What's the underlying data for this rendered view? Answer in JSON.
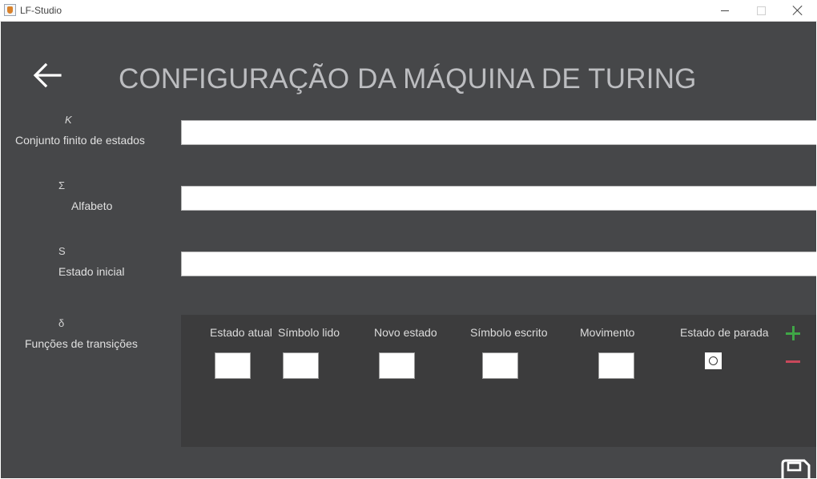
{
  "window": {
    "title": "LF-Studio"
  },
  "header": {
    "title": "CONFIGURAÇÃO DA MÁQUINA DE TURING"
  },
  "fields": [
    {
      "symbol": "K",
      "label": "Conjunto finito de estados",
      "value": ""
    },
    {
      "symbol": "Σ",
      "label": "Alfabeto",
      "value": ""
    },
    {
      "symbol": "S",
      "label": "Estado inicial",
      "value": ""
    }
  ],
  "transitions": {
    "symbol": "δ",
    "label": "Funções de transições",
    "columns": [
      "Estado atual",
      "Símbolo lido",
      "Novo estado",
      "Símbolo escrito",
      "Movimento",
      "Estado de parada"
    ]
  },
  "icons": {
    "back": "arrow-left-icon",
    "add": "plus-icon",
    "remove": "minus-icon",
    "save": "floppy-disk-icon"
  },
  "colors": {
    "background": "#464749",
    "panel": "#3c3c3d",
    "title": "#bcbdc0",
    "add": "#3fa646",
    "remove": "#c9485b"
  }
}
